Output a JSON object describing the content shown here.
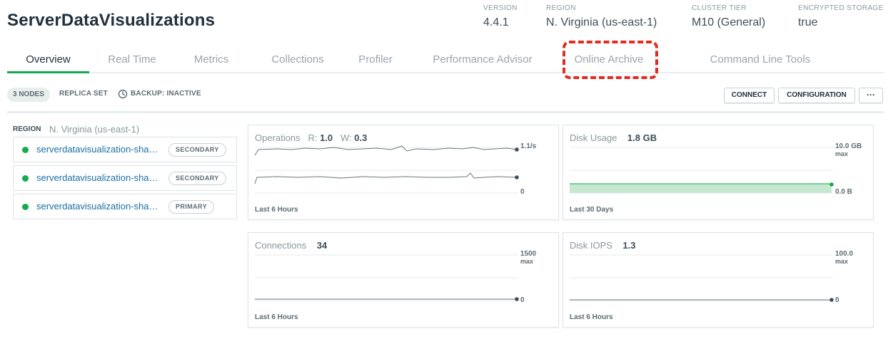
{
  "header": {
    "title": "ServerDataVisualizations",
    "meta": [
      {
        "key": "VERSION",
        "value": "4.4.1"
      },
      {
        "key": "REGION",
        "value": "N. Virginia (us-east-1)"
      },
      {
        "key": "CLUSTER TIER",
        "value": "M10 (General)"
      },
      {
        "key": "ENCRYPTED STORAGE",
        "value": "true"
      }
    ]
  },
  "tabs": [
    "Overview",
    "Real Time",
    "Metrics",
    "Collections",
    "Profiler",
    "Performance Advisor",
    "Online Archive",
    "Command Line Tools"
  ],
  "active_tab": "Overview",
  "subbar": {
    "nodes": "3 NODES",
    "type": "REPLICA SET",
    "backup": "BACKUP: INACTIVE"
  },
  "buttons": {
    "connect": "CONNECT",
    "configuration": "CONFIGURATION",
    "more": "···"
  },
  "region": {
    "label": "REGION",
    "value": "N. Virginia (us-east-1)"
  },
  "nodes": [
    {
      "name": "serverdatavisualization-sha…",
      "role": "SECONDARY"
    },
    {
      "name": "serverdatavisualization-sha…",
      "role": "SECONDARY"
    },
    {
      "name": "serverdatavisualization-sha…",
      "role": "PRIMARY"
    }
  ],
  "cards": {
    "operations": {
      "title": "Operations",
      "r_label": "R:",
      "r": "1.0",
      "w_label": "W:",
      "w": "0.3",
      "ymax": "1.1/s",
      "ymin": "0",
      "footer": "Last 6 Hours"
    },
    "disk_usage": {
      "title": "Disk Usage",
      "value": "1.8 GB",
      "ymax": "10.0 GB",
      "ymax_sub": "max",
      "ymin": "0.0 B",
      "footer": "Last 30 Days"
    },
    "connections": {
      "title": "Connections",
      "value": "34",
      "ymax": "1500",
      "ymax_sub": "max",
      "ymin": "0",
      "footer": "Last 6 Hours"
    },
    "disk_iops": {
      "title": "Disk IOPS",
      "value": "1.3",
      "ymax": "100.0",
      "ymax_sub": "max",
      "ymin": "0",
      "footer": "Last 6 Hours"
    }
  },
  "colors": {
    "accent_green": "#13aa52",
    "link_blue": "#1a6fa3",
    "highlight_red": "#e02c21",
    "disk_fill": "#c7e8d0"
  }
}
